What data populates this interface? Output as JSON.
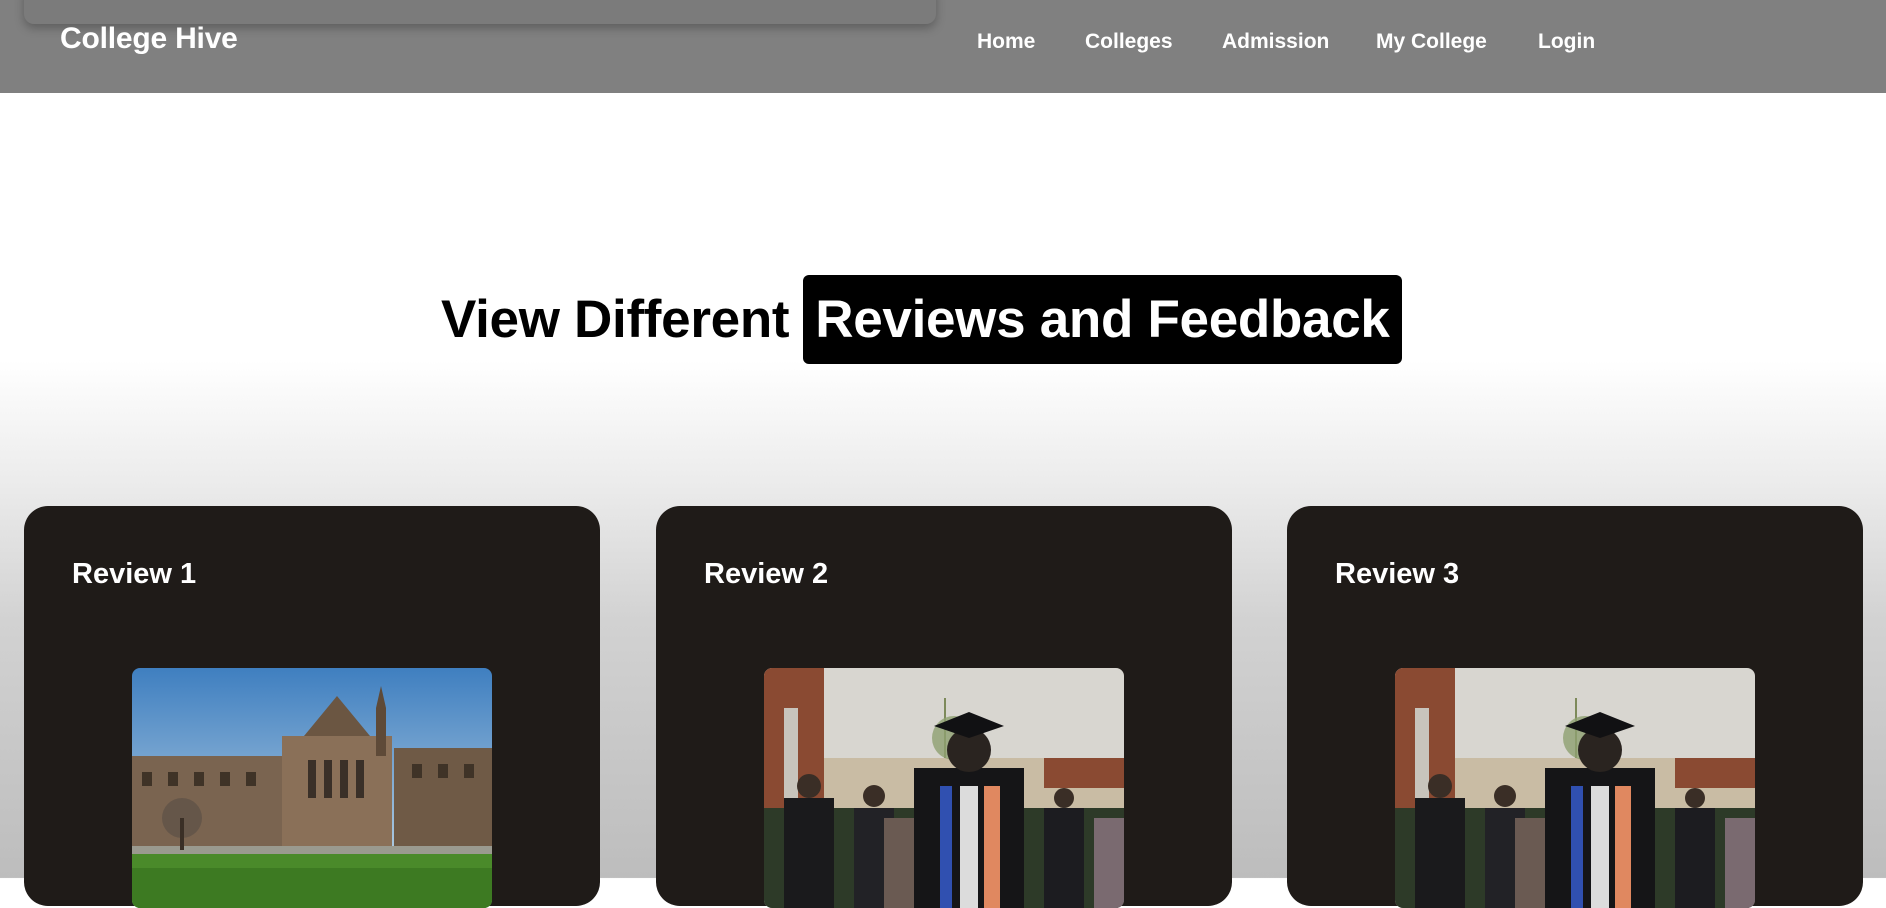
{
  "header": {
    "brand": "College Hive",
    "nav": [
      "Home",
      "Colleges",
      "Admission",
      "My College",
      "Login"
    ]
  },
  "hero": {
    "title_plain": "View Different",
    "title_highlight": "Reviews and Feedback"
  },
  "reviews": [
    {
      "title": "Review 1",
      "image": "university-campus-photo"
    },
    {
      "title": "Review 2",
      "image": "graduation-ceremony-photo"
    },
    {
      "title": "Review 3",
      "image": "graduation-ceremony-photo"
    }
  ],
  "colors": {
    "navbar": "#808080",
    "card": "#1f1b18",
    "highlight": "#000000"
  }
}
